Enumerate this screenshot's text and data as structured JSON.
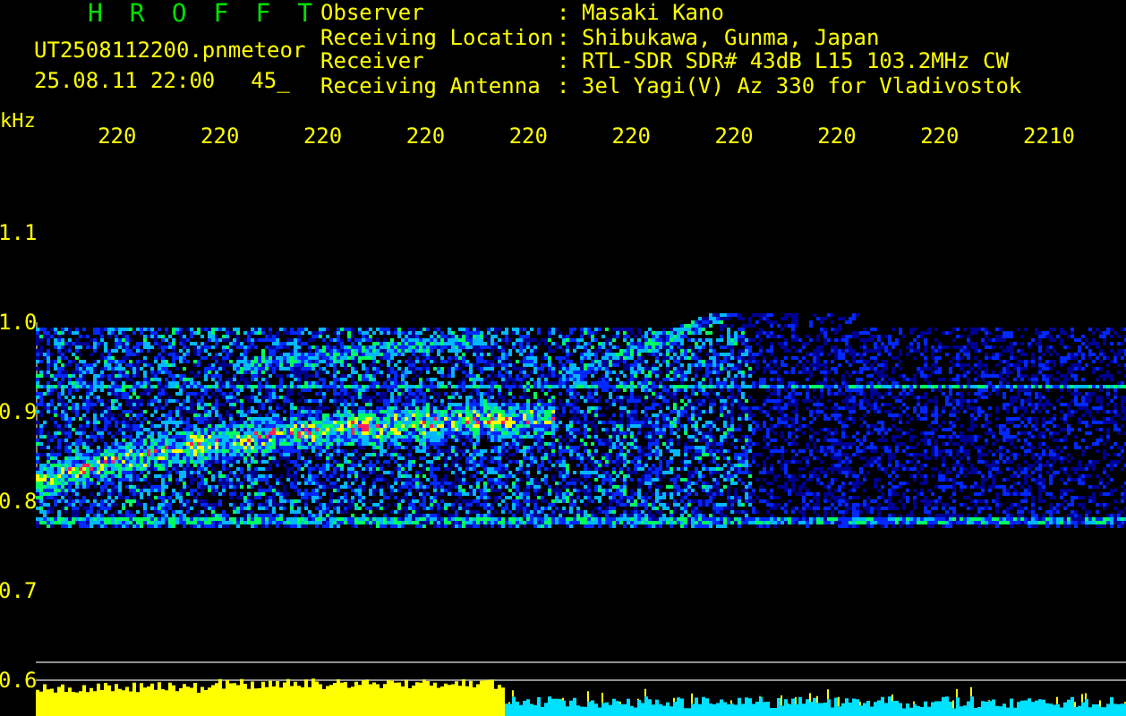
{
  "title": "HROFFT",
  "file": "UT2508112200.pn",
  "mode": "meteor",
  "datetime": "25.08.11 22:00",
  "count": "45_",
  "info": [
    {
      "label": "Observer",
      "separator": ":",
      "value": "Masaki Kano"
    },
    {
      "label": "Receiving Location",
      "separator": ":",
      "value": "Shibukawa, Gunma, Japan"
    },
    {
      "label": "Receiver",
      "separator": ":",
      "value": "RTL-SDR SDR# 43dB L15 103.2MHz CW"
    },
    {
      "label": "Receiving Antenna",
      "separator": ":",
      "value": "3el Yagi(V) Az 330 for Vladivostok"
    }
  ],
  "x_axis": {
    "unit": "kHz",
    "ticks": [
      "220",
      "220",
      "220",
      "220",
      "220",
      "220",
      "220",
      "220",
      "220",
      "2210"
    ]
  },
  "y_axis": {
    "ticks": [
      "1.1",
      "1.0",
      "0.9",
      "0.8",
      "0.7",
      "0.6"
    ]
  }
}
